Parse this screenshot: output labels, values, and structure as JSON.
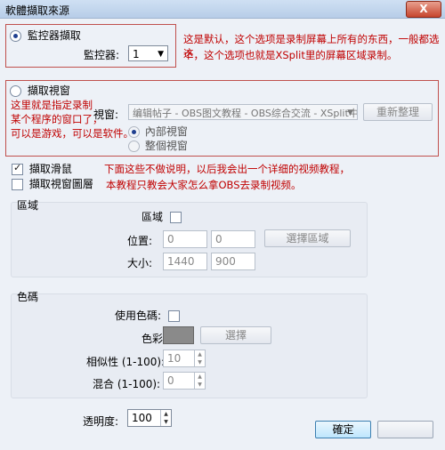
{
  "window": {
    "title": "軟體擷取來源",
    "close_label": "X"
  },
  "monitor_section": {
    "option_label": "監控器擷取",
    "monitor_label": "監控器:",
    "monitor_value": "1",
    "note_line1": "这是默认，这个选项是录制屏幕上所有的东西，一般都选这",
    "note_line2": "个，这个选项也就是XSplit里的屏幕区域录制。"
  },
  "window_section": {
    "option_label": "擷取視窗",
    "note_lines": [
      "这里就是指定录制",
      "某个程序的窗口了，",
      "可以是游戏，可以是软件。"
    ],
    "window_label": "視窗:",
    "window_value": "编辑帖子 - OBS图文教程 - OBS综合交流 - XSplit中文论",
    "refresh_label": "重新整理",
    "inner_label": "內部視窗",
    "full_label": "整個視窗"
  },
  "options": {
    "capture_mouse_label": "擷取滑鼠",
    "capture_layered_label": "擷取視窗圖層",
    "note_line1": "下面这些不做说明，以后我会出一个详细的视频教程，",
    "note_line2": "本教程只教会大家怎么拿OBS去录制视频。"
  },
  "region": {
    "group_title": "區域",
    "region_label": "區域",
    "position_label": "位置:",
    "pos_x": "0",
    "pos_y": "0",
    "select_region_label": "選擇區域",
    "size_label": "大小:",
    "width": "1440",
    "height": "900"
  },
  "colorkey": {
    "group_title": "色碼",
    "use_label": "使用色碼:",
    "color_label": "色彩",
    "color_value": "#8a8a8a",
    "choose_label": "選擇",
    "similarity_label": "相似性 (1-100):",
    "similarity_value": "10",
    "blend_label": "混合 (1-100):",
    "blend_value": "0"
  },
  "opacity": {
    "label": "透明度:",
    "value": "100"
  },
  "footer": {
    "ok_label": "確定"
  }
}
